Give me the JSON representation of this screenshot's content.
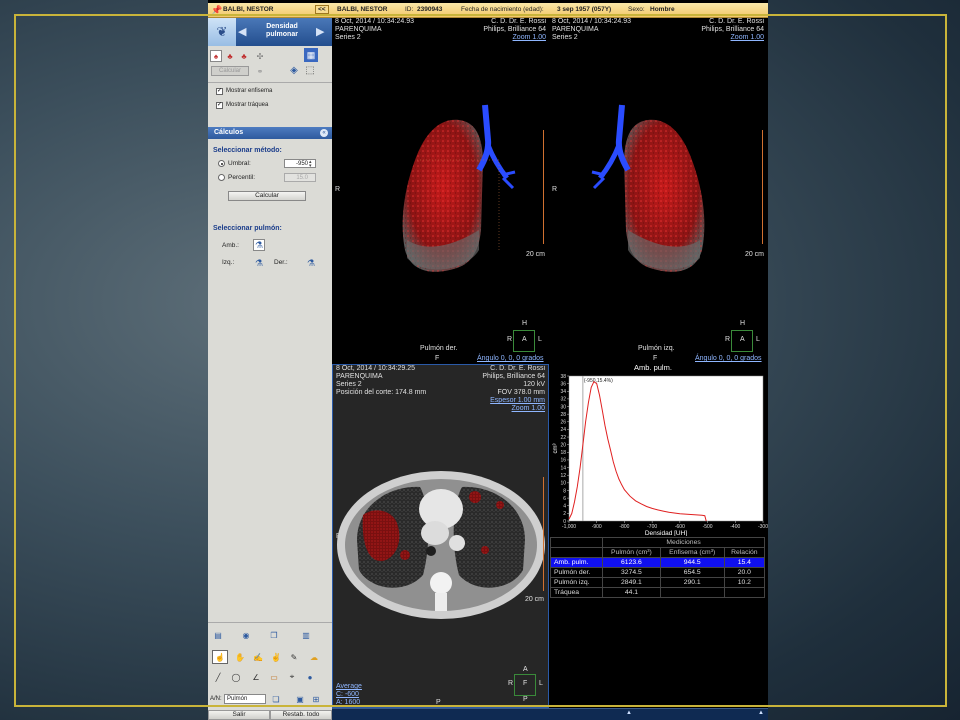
{
  "patient": {
    "name": "BALBI, NESTOR",
    "id_label": "ID:",
    "id": "2390943",
    "dob_label": "Fecha de nacimiento (edad):",
    "dob": "3 sep 1957 (057Y)",
    "sex_label": "Sexo:",
    "sex": "Hombre",
    "collapse": "<<"
  },
  "panel": {
    "title": "Densidad pulmonar",
    "calc_button": "Calcular",
    "show_emphysema": "Mostrar enfisema",
    "show_trachea": "Mostrar tráquea",
    "calc_section": "Cálculos",
    "method_heading": "Seleccionar método:",
    "threshold_label": "Umbral:",
    "threshold_value": "-950",
    "percentile_label": "Percentil:",
    "percentile_value": "15.0",
    "calcular": "Calcular",
    "lung_heading": "Seleccionar pulmón:",
    "amb": "Amb.:",
    "izq": "Izq.:",
    "der": "Der.:",
    "an_label": "A/N:",
    "an_value": "Pulmón",
    "exit": "Salir",
    "reset": "Restab. todo"
  },
  "vr_left": {
    "date": "8 Oct, 2014 / 10:34:24.93",
    "series_desc": "PARENQUIMA",
    "series": "Series 2",
    "institution": "C. D. Dr. E. Rossi",
    "scanner": "Philips, Brilliance 64",
    "zoom": "Zoom 1.00",
    "orient_r": "R",
    "scale": "20 cm",
    "label": "Pulmón der.",
    "bottom": "F",
    "angle": "Ángulo 0, 0, 0  grados",
    "cube": {
      "top": "H",
      "left": "R",
      "center": "A",
      "right": "L",
      "bottom": "F"
    }
  },
  "vr_right": {
    "date": "8 Oct, 2014 / 10:34:24.93",
    "series_desc": "PARENQUIMA",
    "series": "Series 2",
    "institution": "C. D. Dr. E. Rossi",
    "scanner": "Philips, Brilliance 64",
    "zoom": "Zoom 1.00",
    "orient_r": "R",
    "scale": "20 cm",
    "label": "Pulmón izq.",
    "bottom": "F",
    "angle": "Ángulo 0, 0, 0  grados",
    "cube": {
      "top": "H",
      "left": "R",
      "center": "A",
      "right": "L",
      "bottom": "F"
    }
  },
  "ct": {
    "date": "8 Oct, 2014 / 10:34:29.25",
    "series_desc": "PARENQUIMA",
    "series": "Series 2",
    "position": "Posición del corte: 174.8 mm",
    "institution": "C. D. Dr. E. Rossi",
    "scanner": "Philips, Brilliance 64",
    "kv": "120 kV",
    "fov": "FOV 378.0 mm",
    "thickness": "Espesor 1.00 mm",
    "zoom": "Zoom 1.00",
    "orient_r": "R",
    "scale": "20 cm",
    "mode": "Average",
    "c": "C: -600",
    "a": "A: 1600",
    "bottom": "P",
    "cube": {
      "top": "A",
      "left": "R",
      "center": "F",
      "right": "L",
      "bottom": "P"
    }
  },
  "chart_title": "Amb. pulm.",
  "chart_data": {
    "type": "line",
    "title": "",
    "xlabel": "Densidad [UH]",
    "ylabel": "cm³",
    "xlim": [
      -1000,
      -300
    ],
    "ylim": [
      0,
      38
    ],
    "xticks": [
      -1000,
      -900,
      -800,
      -700,
      -600,
      -500,
      -400,
      -300
    ],
    "xtick_labels": [
      "-1,000",
      "-900",
      "-800",
      "-700",
      "-600",
      "-500",
      "-400",
      "-300"
    ],
    "yticks": [
      0,
      2,
      4,
      6,
      8,
      10,
      12,
      14,
      16,
      18,
      20,
      22,
      24,
      26,
      28,
      30,
      32,
      34,
      36,
      38
    ],
    "threshold_x": -950,
    "threshold_label": "(-950,15.4%)",
    "series": [
      {
        "color": "#e02020",
        "x": [
          -1000,
          -990,
          -980,
          -970,
          -960,
          -950,
          -940,
          -930,
          -920,
          -910,
          -900,
          -890,
          -880,
          -870,
          -860,
          -850,
          -840,
          -830,
          -820,
          -810,
          -800,
          -780,
          -760,
          -740,
          -720,
          -700,
          -680,
          -660,
          -640,
          -620,
          -600,
          -580,
          -560,
          -540,
          -520,
          -510,
          -505
        ],
        "y": [
          0.5,
          2,
          5,
          9,
          14,
          20,
          26,
          31,
          35,
          36.5,
          36,
          33,
          29,
          25,
          21.5,
          18.5,
          15.5,
          13,
          11,
          9.5,
          8.2,
          6.5,
          5.3,
          4.5,
          3.8,
          3.3,
          2.9,
          2.6,
          2.3,
          2.1,
          1.9,
          1.8,
          1.7,
          1.6,
          1.5,
          1.4,
          0
        ]
      }
    ]
  },
  "measurements": {
    "title": "Mediciones",
    "headers": [
      "",
      "Pulmón (cm³)",
      "Enfisema (cm³)",
      "Relación"
    ],
    "rows": [
      [
        "Amb. pulm.",
        "6123.6",
        "944.5",
        "15.4"
      ],
      [
        "Pulmón der.",
        "3274.5",
        "654.5",
        "20.0"
      ],
      [
        "Pulmón izq.",
        "2849.1",
        "290.1",
        "10.2"
      ],
      [
        "Tráquea",
        "44.1",
        "",
        ""
      ]
    ]
  },
  "colors": {
    "accent": "#1010f0",
    "frame": "#c9b43a",
    "lung": "#b01818",
    "trachea": "#2a4cff"
  }
}
